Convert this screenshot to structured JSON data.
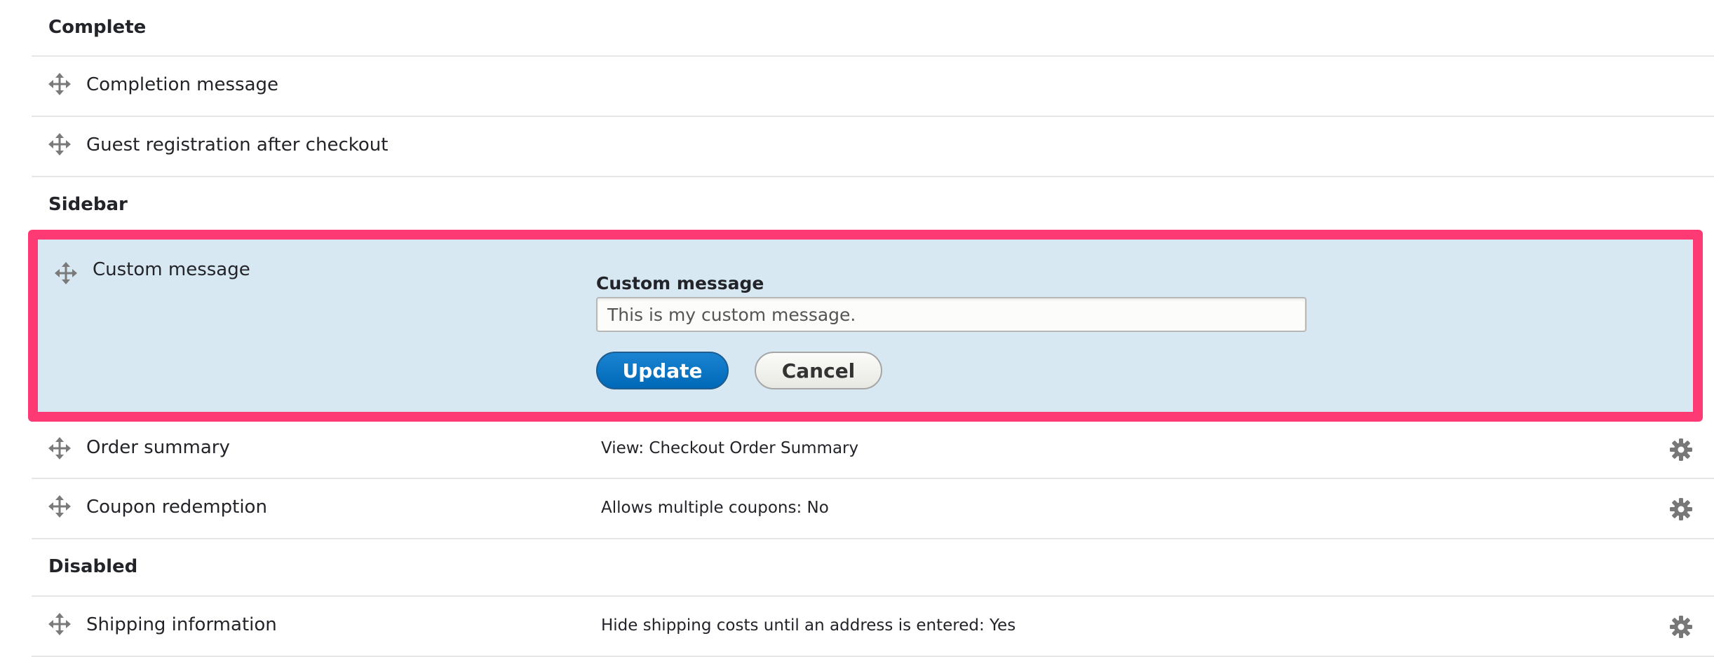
{
  "regions": {
    "complete": {
      "title": "Complete"
    },
    "sidebar": {
      "title": "Sidebar"
    },
    "disabled": {
      "title": "Disabled"
    }
  },
  "panes": {
    "completion_message": {
      "label": "Completion message"
    },
    "guest_registration": {
      "label": "Guest registration after checkout"
    },
    "custom_message": {
      "label": "Custom message",
      "form": {
        "field_label": "Custom message",
        "field_value": "This is my custom message.",
        "update_label": "Update",
        "cancel_label": "Cancel"
      }
    },
    "order_summary": {
      "label": "Order summary",
      "summary": "View: Checkout Order Summary"
    },
    "coupon_redemption": {
      "label": "Coupon redemption",
      "summary": "Allows multiple coupons: No"
    },
    "shipping_information": {
      "label": "Shipping information",
      "summary": "Hide shipping costs until an address is entered: Yes"
    }
  },
  "icons": {
    "drag": "move-arrows-icon",
    "settings": "gear-icon"
  },
  "colors": {
    "highlight_border": "#fe3a75",
    "editing_background": "#d7e8f2",
    "primary_button": "#0071c2",
    "icon_gray": "#787878"
  }
}
